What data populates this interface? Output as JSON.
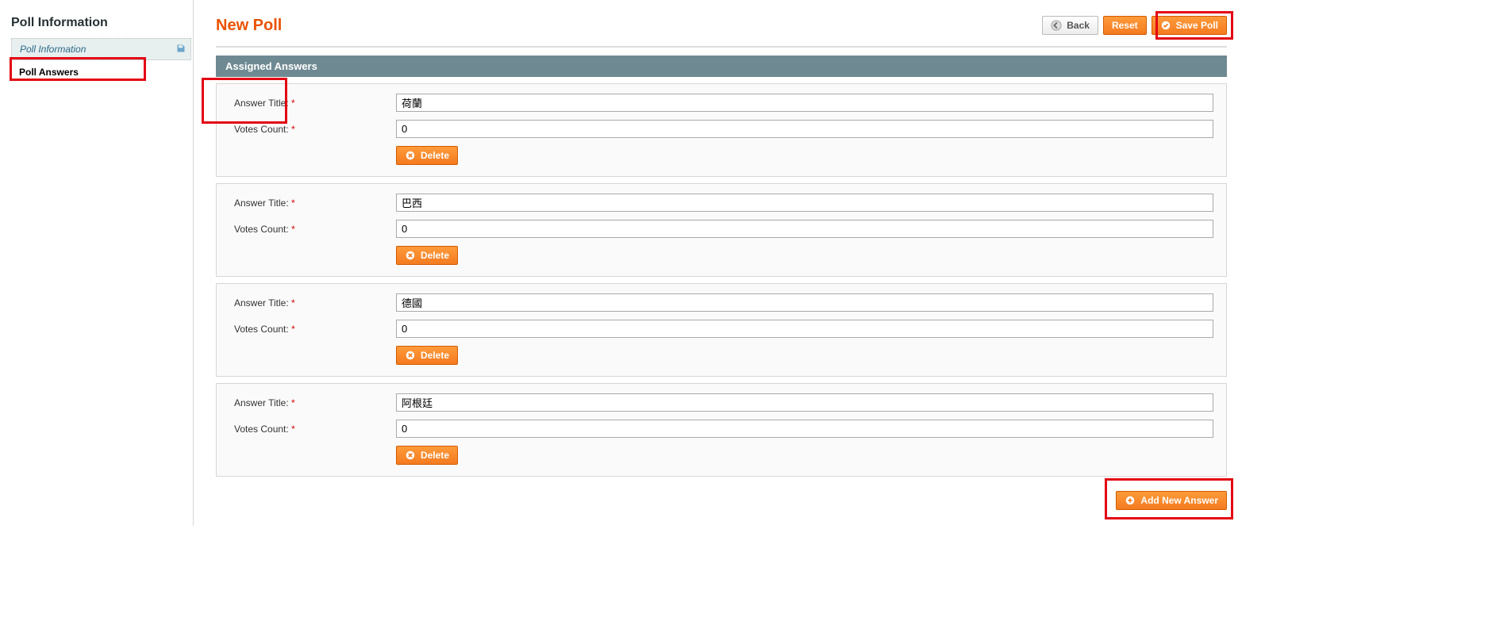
{
  "sidebar": {
    "title": "Poll Information",
    "items": [
      {
        "label": "Poll Information"
      },
      {
        "label": "Poll Answers"
      }
    ]
  },
  "header": {
    "title": "New Poll",
    "buttons": {
      "back": "Back",
      "reset": "Reset",
      "save": "Save Poll"
    }
  },
  "section": {
    "title": "Assigned Answers"
  },
  "labels": {
    "answer_title": "Answer Title:",
    "votes_count": "Votes Count:",
    "delete": "Delete",
    "add_new": "Add New Answer"
  },
  "answers": [
    {
      "title": "荷蘭",
      "votes": "0"
    },
    {
      "title": "巴西",
      "votes": "0"
    },
    {
      "title": "德國",
      "votes": "0"
    },
    {
      "title": "阿根廷",
      "votes": "0"
    }
  ]
}
